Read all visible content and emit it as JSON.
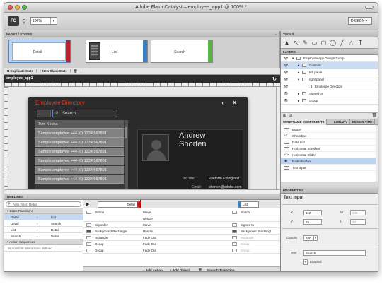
{
  "window": {
    "title": "Adobe Flash Catalyst – employee_app1 @ 100% *"
  },
  "toolbar": {
    "logo": "FC",
    "zoom": "100%",
    "workspace": "DESIGN"
  },
  "pages_panel": {
    "title": "PAGES / STATES",
    "states": [
      {
        "label": "Detail",
        "color": "#b8232a"
      },
      {
        "label": "List",
        "color": "#3c7fc4"
      },
      {
        "label": "Search",
        "color": "#58b344"
      }
    ],
    "duplicate_label": "Duplicate State",
    "new_blank_label": "New Blank State"
  },
  "document": {
    "tab": "employee_app1"
  },
  "app": {
    "title": "Employee Directory",
    "search_placeholder": "Search",
    "list": [
      "Tom Kircha",
      "Sample employee +44 (0) 1234 567891",
      "Sample employee +44 (0) 1234 567891",
      "Sample employee +44 (0) 1234 567891",
      "Sample employee +44 (0) 1234 567891",
      "Sample employee +44 (0) 1234 567891",
      "Sample employee +44 (0) 1234 567891"
    ],
    "detail": {
      "first_name": "Andrew",
      "last_name": "Shorten",
      "job_title_label": "Job title:",
      "job_title": "Platform Evangelist",
      "email_label": "Email:",
      "email": "shorten@adobe.com"
    }
  },
  "timelines": {
    "title": "TIMELINES",
    "filter_placeholder": "Auto Filter: Detail",
    "group_state": "State Transitions",
    "transitions": [
      {
        "from": "Detail",
        "to": "List"
      },
      {
        "from": "Detail",
        "to": "Search"
      },
      {
        "from": "List",
        "to": "Detail"
      },
      {
        "from": "Search",
        "to": "Detail"
      }
    ],
    "group_action": "Action Sequences",
    "no_interactions": "No custom interactions defined",
    "from_state": "Detail",
    "to_state": "List",
    "left_rows": [
      "Button",
      "",
      "Signed In",
      "Background Rectangle",
      "rectangle",
      "Group",
      "Group"
    ],
    "effects": [
      "Move",
      "Resize",
      "Move",
      "Resize",
      "Fade Out",
      "Fade Out",
      "Fade Out"
    ],
    "right_rows": [
      "Button",
      "",
      "Signed In",
      "Background Rectangl",
      "rectangle",
      "Group",
      "Group"
    ],
    "add_action": "Add Action",
    "add_object": "Add Object",
    "smooth": "Smooth Transition"
  },
  "tools_panel": {
    "title": "TOOLS",
    "tools": [
      "▲",
      "↖",
      "✎",
      "▭",
      "▢",
      "◯",
      "╱",
      "△",
      "T"
    ]
  },
  "layers_panel": {
    "title": "LAYERS",
    "items": [
      {
        "label": "Employee App Design Comp",
        "indent": 0
      },
      {
        "label": "Controls",
        "indent": 1
      },
      {
        "label": "left panel",
        "indent": 1
      },
      {
        "label": "right panel",
        "indent": 1
      },
      {
        "label": "Employee Directory",
        "indent": 2
      },
      {
        "label": "Signed In",
        "indent": 1
      },
      {
        "label": "Group",
        "indent": 1
      }
    ]
  },
  "wireframe_panel": {
    "tabs": [
      "WIREFRAME COMPONENTS",
      "LIBRARY",
      "DESIGN-TIME"
    ],
    "items": [
      "Button",
      "Checkbox",
      "Data List",
      "Horizontal Scrollbar",
      "Horizontal Slider",
      "Radio Button",
      "Text Input"
    ]
  },
  "properties_panel": {
    "title": "PROPERTIES",
    "component": "Text Input",
    "x_label": "X",
    "x": "112",
    "w_label": "W",
    "w": "236",
    "y_label": "Y",
    "y": "55",
    "h_label": "H",
    "h": "20",
    "opacity_label": "Opacity",
    "opacity": "100",
    "text_label": "Text",
    "text": "Search",
    "enabled_label": "Enabled"
  }
}
